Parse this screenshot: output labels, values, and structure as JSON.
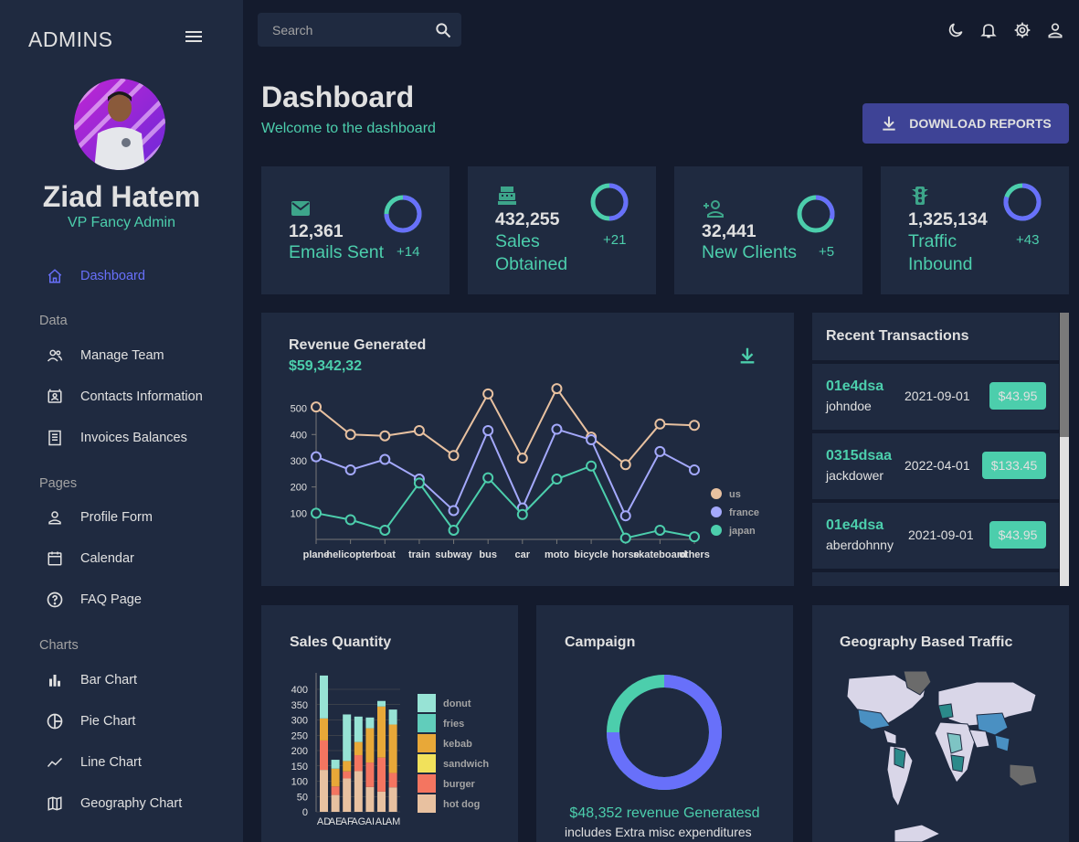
{
  "brand": "ADMINS",
  "user": {
    "name": "Ziad Hatem",
    "role": "VP Fancy Admin"
  },
  "nav": {
    "dashboard": "Dashboard",
    "section_data": "Data",
    "manage_team": "Manage Team",
    "contacts": "Contacts Information",
    "invoices": "Invoices Balances",
    "section_pages": "Pages",
    "profile": "Profile Form",
    "calendar": "Calendar",
    "faq": "FAQ Page",
    "section_charts": "Charts",
    "bar": "Bar Chart",
    "pie": "Pie Chart",
    "line": "Line Chart",
    "geo": "Geography Chart"
  },
  "search": {
    "placeholder": "Search"
  },
  "header": {
    "title": "Dashboard",
    "subtitle": "Welcome to the dashboard",
    "download": "DOWNLOAD REPORTS"
  },
  "stats": [
    {
      "value": "12,361",
      "label1": "Emails Sent",
      "label2": "",
      "increase": "+14",
      "progress": 0.75,
      "icon": "email-icon"
    },
    {
      "value": "432,255",
      "label1": "Sales",
      "label2": "Obtained",
      "increase": "+21",
      "progress": 0.5,
      "icon": "point-of-sale-icon"
    },
    {
      "value": "32,441",
      "label1": "New Clients",
      "label2": "",
      "increase": "+5",
      "progress": 0.3,
      "icon": "person-add-icon"
    },
    {
      "value": "1,325,134",
      "label1": "Traffic",
      "label2": "Inbound",
      "increase": "+43",
      "progress": 0.8,
      "icon": "traffic-icon"
    }
  ],
  "revenue": {
    "title": "Revenue Generated",
    "amount": "$59,342,32"
  },
  "transactions": {
    "title": "Recent Transactions",
    "items": [
      {
        "id": "01e4dsa",
        "user": "johndoe",
        "date": "2021-09-01",
        "cost": "$43.95"
      },
      {
        "id": "0315dsaa",
        "user": "jackdower",
        "date": "2022-04-01",
        "cost": "$133.45"
      },
      {
        "id": "01e4dsa",
        "user": "aberdohnny",
        "date": "2021-09-01",
        "cost": "$43.95"
      }
    ]
  },
  "sales_quantity": {
    "title": "Sales Quantity"
  },
  "campaign": {
    "title": "Campaign",
    "revenue": "$48,352 revenue Generatesd",
    "note": "includes Extra misc expenditures",
    "progress": 0.75
  },
  "geography": {
    "title": "Geography Based Traffic"
  },
  "colors": {
    "primary": "#141b2d",
    "panel": "#1f2a40",
    "accent": "#4cceac",
    "blue": "#6870fa",
    "button": "#3e4396"
  },
  "chart_data": [
    {
      "type": "line",
      "categories": [
        "plane",
        "helicopter",
        "boat",
        "train",
        "subway",
        "bus",
        "car",
        "moto",
        "bicycle",
        "horse",
        "skateboard",
        "others"
      ],
      "series": [
        {
          "name": "us",
          "color": "#e8c1a0",
          "values": [
            505,
            400,
            395,
            415,
            320,
            555,
            310,
            575,
            390,
            285,
            440,
            435
          ]
        },
        {
          "name": "france",
          "color": "#a4a9fc",
          "values": [
            315,
            265,
            305,
            230,
            110,
            415,
            120,
            420,
            380,
            90,
            335,
            265
          ]
        },
        {
          "name": "japan",
          "color": "#4cceac",
          "values": [
            100,
            75,
            35,
            215,
            35,
            235,
            95,
            230,
            280,
            5,
            35,
            10
          ]
        }
      ],
      "yticks": [
        100,
        200,
        300,
        400,
        500
      ],
      "ylim": [
        0,
        600
      ]
    },
    {
      "type": "bar",
      "stacked": true,
      "categories": [
        "AD",
        "AE",
        "AF",
        "AG",
        "AI",
        "AL",
        "AM"
      ],
      "yticks": [
        0,
        50,
        100,
        150,
        200,
        250,
        300,
        350,
        400
      ],
      "ylim": [
        0,
        450
      ],
      "series": [
        {
          "name": "hot dog",
          "color": "#e8c1a0",
          "values": [
            137,
            55,
            109,
            133,
            81,
            66,
            80
          ]
        },
        {
          "name": "burger",
          "color": "#f47560",
          "values": [
            96,
            28,
            23,
            52,
            80,
            111,
            47
          ]
        },
        {
          "name": "sandwich",
          "color": "#e8a838",
          "values": [
            72,
            58,
            34,
            43,
            112,
            167,
            158
          ]
        },
        {
          "name": "kebab",
          "color": "#f1e15b",
          "values": [
            0,
            0,
            0,
            0,
            0,
            0,
            0
          ]
        },
        {
          "name": "fries",
          "color": "#61cdbb",
          "values": [
            0,
            0,
            0,
            0,
            0,
            0,
            0
          ]
        },
        {
          "name": "donut",
          "color": "#97e3d5",
          "values": [
            140,
            29,
            152,
            83,
            35,
            18,
            49
          ]
        }
      ],
      "legend": [
        "donut",
        "fries",
        "kebab",
        "sandwich",
        "burger",
        "hot dog"
      ],
      "legend_colors": [
        "#97e3d5",
        "#61cdbb",
        "#e8a838",
        "#f1e15b",
        "#f47560",
        "#e8c1a0"
      ]
    }
  ]
}
